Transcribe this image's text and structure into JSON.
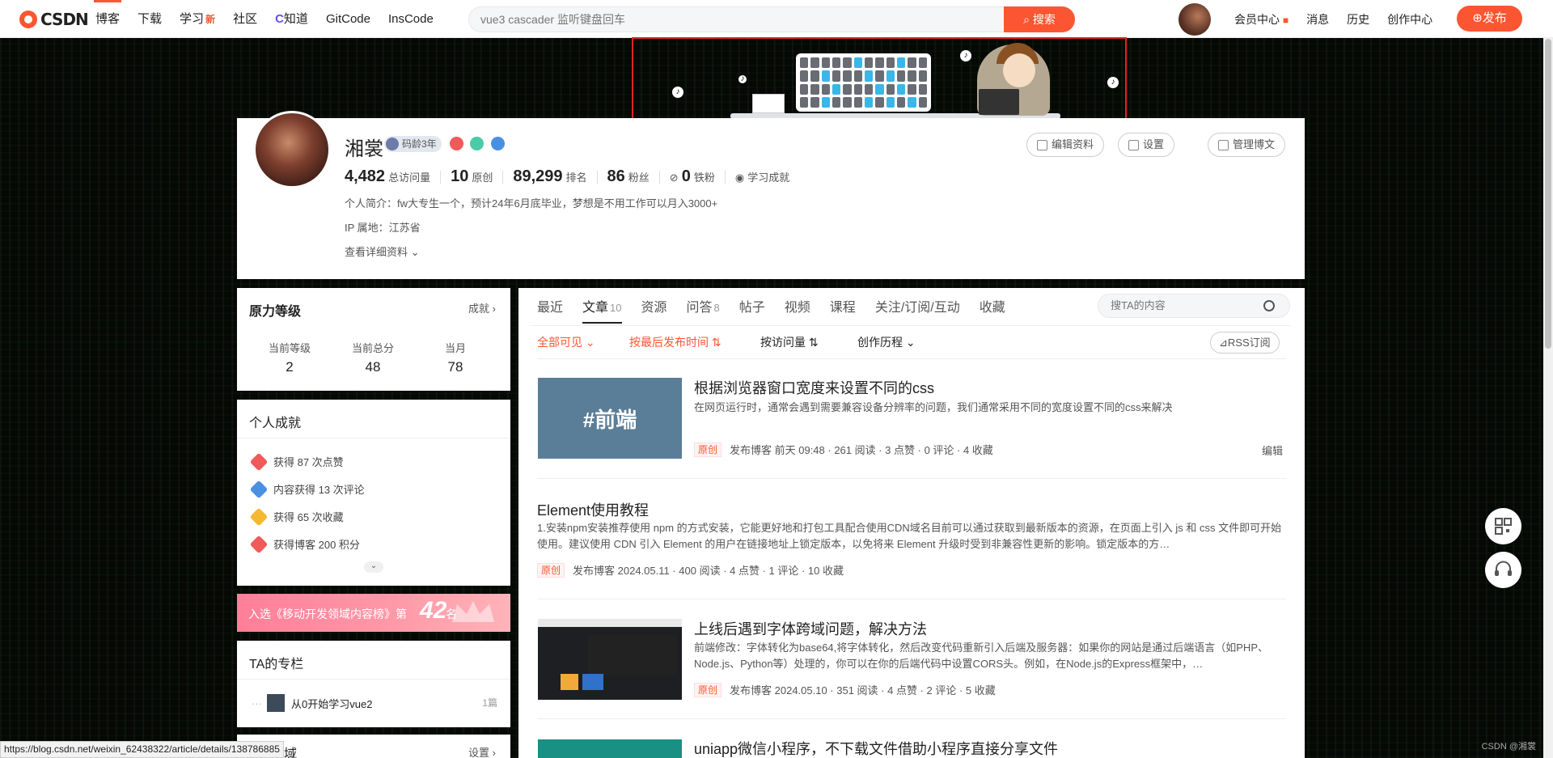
{
  "topbar": {
    "logo_text": "CSDN",
    "nav": [
      {
        "label": "博客",
        "active": true
      },
      {
        "label": "下载",
        "active": false
      },
      {
        "label": "学习",
        "active": false,
        "badge": "新"
      },
      {
        "label": "社区",
        "active": false
      },
      {
        "label": "知道",
        "active": false
      },
      {
        "label": "GitCode",
        "active": false
      },
      {
        "label": "InsCode",
        "active": false
      }
    ],
    "search_value": "vue3 cascader 监听键盘回车",
    "search_button": "搜索",
    "links": [
      "会员中心",
      "消息",
      "历史",
      "创作中心"
    ],
    "publish_button": "发布"
  },
  "profile": {
    "name": "湘裳",
    "age_badge": "码龄3年",
    "stats": [
      {
        "value": "4,482",
        "label": "总访问量"
      },
      {
        "value": "10",
        "label": "原创"
      },
      {
        "value": "89,299",
        "label": "排名"
      },
      {
        "value": "86",
        "label": "粉丝"
      },
      {
        "value": "0",
        "label": "铁粉"
      }
    ],
    "learn_link": "学习成就",
    "bio": "个人简介：fw大专生一个，预计24年6月底毕业，梦想是不用工作可以月入3000+",
    "ip": "IP 属地：江苏省",
    "more": "查看详细资料",
    "buttons": [
      "编辑资料",
      "设置",
      "管理博文"
    ]
  },
  "level_card": {
    "title": "原力等级",
    "link": "成就",
    "items": [
      {
        "label": "当前等级",
        "value": "2"
      },
      {
        "label": "当前总分",
        "value": "48"
      },
      {
        "label": "当月",
        "value": "78"
      }
    ]
  },
  "achievements": {
    "title": "个人成就",
    "items": [
      {
        "text": "获得 87 次点赞",
        "color": "#f05a5a"
      },
      {
        "text": "内容获得 13 次评论",
        "color": "#4a90e2"
      },
      {
        "text": "获得 65 次收藏",
        "color": "#f5b82e"
      },
      {
        "text": "获得博客 200 积分",
        "color": "#f05a5a"
      }
    ]
  },
  "rank_banner": {
    "text": "入选《移动开发领域内容榜》第",
    "num": "42",
    "suffix": "名"
  },
  "column_card": {
    "title": "TA的专栏",
    "items": [
      {
        "name": "从0开始学习vue2",
        "count": "1篇"
      }
    ]
  },
  "next_card": {
    "title": "域",
    "link": "设置"
  },
  "main": {
    "tabs": [
      {
        "label": "最近",
        "count": "",
        "active": false
      },
      {
        "label": "文章",
        "count": "10",
        "active": true
      },
      {
        "label": "资源",
        "count": "",
        "active": false
      },
      {
        "label": "问答",
        "count": "8",
        "active": false
      },
      {
        "label": "帖子",
        "count": "",
        "active": false
      },
      {
        "label": "视频",
        "count": "",
        "active": false
      },
      {
        "label": "课程",
        "count": "",
        "active": false
      },
      {
        "label": "关注/订阅/互动",
        "count": "",
        "active": false
      },
      {
        "label": "收藏",
        "count": "",
        "active": false
      }
    ],
    "search_placeholder": "搜TA的内容",
    "filters": [
      "全部可见",
      "按最后发布时间",
      "按访问量",
      "创作历程"
    ],
    "rss": "RSS订阅",
    "articles": [
      {
        "title": "根据浏览器窗口宽度来设置不同的css",
        "desc": "在网页运行时，通常会遇到需要兼容设备分辨率的问题，我们通常采用不同的宽度设置不同的css来解决",
        "tag": "原创",
        "meta": "发布博客 前天 09:48 · 261 阅读 · 3 点赞 · 0 评论 · 4 收藏",
        "thumb_text": "#前端",
        "edit": "编辑"
      },
      {
        "title": "Element使用教程",
        "desc": "1.安装npm安装推荐使用 npm 的方式安装，它能更好地和打包工具配合使用CDN域名目前可以通过获取到最新版本的资源，在页面上引入 js 和 css 文件即可开始使用。建议使用 CDN 引入 Element 的用户在链接地址上锁定版本，以免将来 Element 升级时受到非兼容性更新的影响。锁定版本的方…",
        "tag": "原创",
        "meta": "发布博客 2024.05.11 · 400 阅读 · 4 点赞 · 1 评论 · 10 收藏"
      },
      {
        "title": "上线后遇到字体跨域问题，解决方法",
        "desc": "前端修改：字体转化为base64,将字体转化，然后改变代码重新引入后端及服务器：如果你的网站是通过后端语言（如PHP、Node.js、Python等）处理的，你可以在你的后端代码中设置CORS头。例如，在Node.js的Express框架中，…",
        "tag": "原创",
        "meta": "发布博客 2024.05.10 · 351 阅读 · 4 点赞 · 2 评论 · 5 收藏"
      },
      {
        "title": "uniapp微信小程序，不下载文件借助小程序直接分享文件"
      }
    ]
  },
  "status_url": "https://blog.csdn.net/weixin_62438322/article/details/138786885",
  "watermark": "CSDN @湘裳"
}
